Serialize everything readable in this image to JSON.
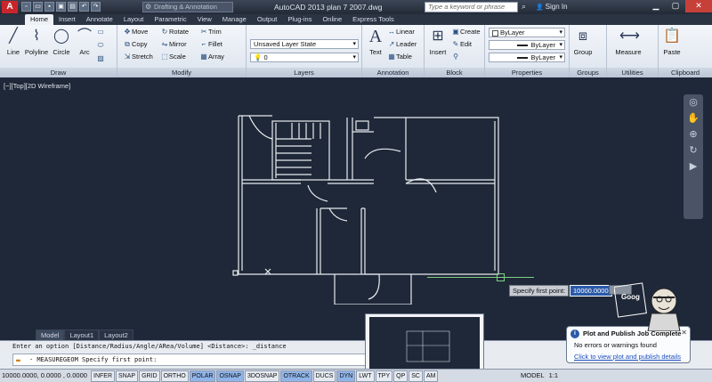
{
  "titlebar": {
    "app_logo": "A",
    "workspace": "Drafting & Annotation",
    "title": "AutoCAD 2013 plan 7 2007.dwg",
    "search_placeholder": "Type a keyword or phrase",
    "signin": "Sign In"
  },
  "tabs": [
    "Home",
    "Insert",
    "Annotate",
    "Layout",
    "Parametric",
    "View",
    "Manage",
    "Output",
    "Plug-ins",
    "Online",
    "Express Tools"
  ],
  "ribbon": {
    "draw": {
      "title": "Draw",
      "line": "Line",
      "polyline": "Polyline",
      "circle": "Circle",
      "arc": "Arc"
    },
    "modify": {
      "title": "Modify",
      "move": "Move",
      "rotate": "Rotate",
      "trim": "Trim",
      "copy": "Copy",
      "mirror": "Mirror",
      "fillet": "Fillet",
      "stretch": "Stretch",
      "scale": "Scale",
      "array": "Array"
    },
    "layers": {
      "title": "Layers",
      "layer_state": "Unsaved Layer State",
      "current_layer": "0"
    },
    "annotation": {
      "title": "Annotation",
      "text": "Text",
      "linear": "Linear",
      "leader": "Leader",
      "table": "Table"
    },
    "block": {
      "title": "Block",
      "insert": "Insert",
      "create": "Create",
      "edit": "Edit"
    },
    "properties": {
      "title": "Properties",
      "color": "ByLayer",
      "linetype": "ByLayer",
      "lineweight": "ByLayer"
    },
    "groups": {
      "title": "Groups",
      "group": "Group"
    },
    "utilities": {
      "title": "Utilities",
      "measure": "Measure"
    },
    "clipboard": {
      "title": "Clipboard",
      "paste": "Paste"
    }
  },
  "viewport": {
    "label": "[−][Top][2D Wireframe]",
    "tooltip_prompt": "Specify first point:",
    "tooltip_value": "10000.0000"
  },
  "layout_tabs": [
    "Model",
    "Layout1",
    "Layout2"
  ],
  "command": {
    "history": "Enter an option [Distance/Radius/Angle/ARea/Volume] <Distance>: _distance",
    "current": "- MEASUREGEOM Specify first point:"
  },
  "status": {
    "coords": "10000.0000, 0.0000 , 0.0000",
    "toggles": [
      "INFER",
      "SNAP",
      "GRID",
      "ORTHO",
      "POLAR",
      "OSNAP",
      "3DOSNAP",
      "OTRACK",
      "DUCS",
      "DYN",
      "LWT",
      "TPY",
      "QP",
      "SC",
      "AM"
    ],
    "model": "MODEL",
    "scale": "1:1"
  },
  "balloon": {
    "title": "Plot and Publish Job Complete",
    "message": "No errors or warnings found",
    "link": "Click to view plot and publish details"
  },
  "mascot": {
    "text": "Google Teacher Mohammad"
  }
}
